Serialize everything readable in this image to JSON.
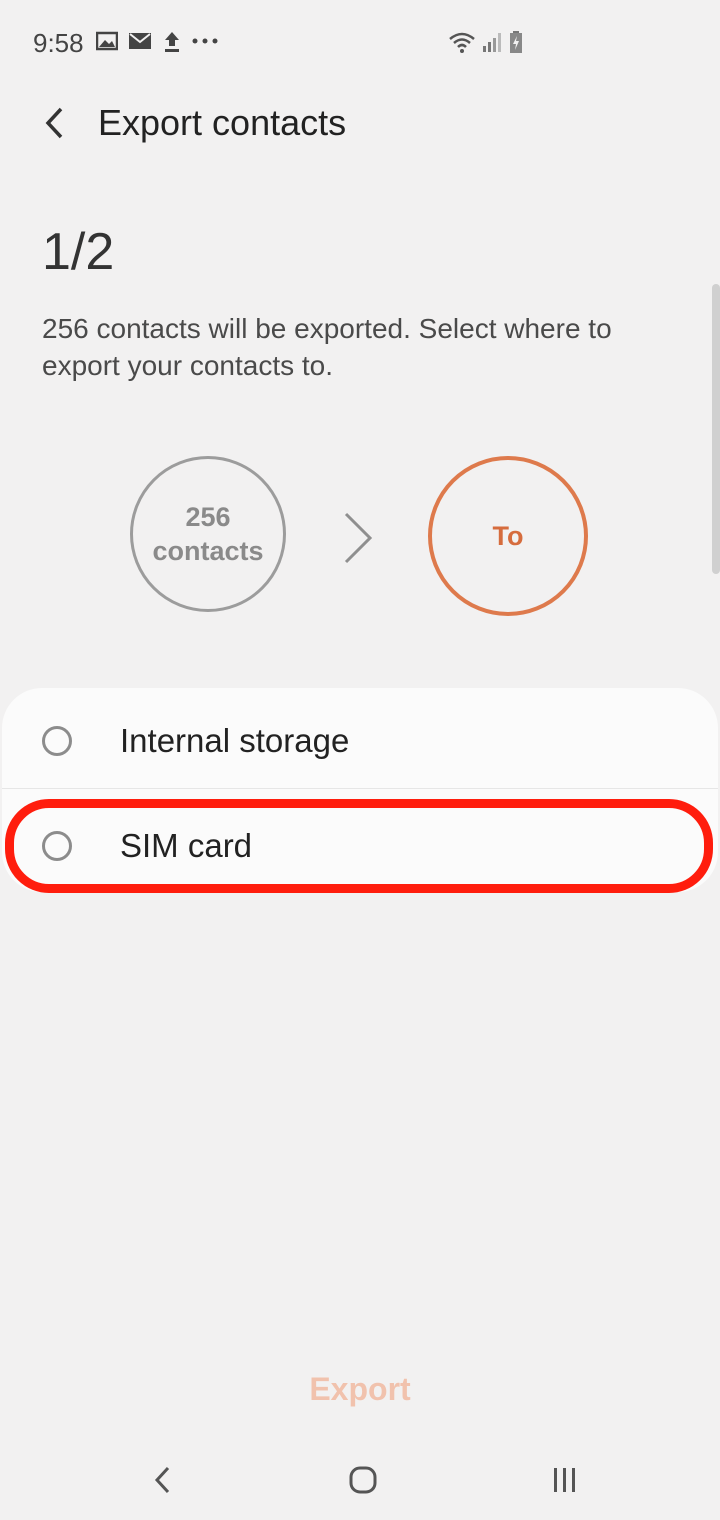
{
  "status_bar": {
    "time": "9:58",
    "left_icons": [
      "image-icon",
      "mail-icon",
      "upload-icon",
      "more-dots-icon"
    ],
    "right_icons": [
      "wifi-icon",
      "signal-icon",
      "battery-charging-icon"
    ]
  },
  "header": {
    "title": "Export contacts"
  },
  "step": "1/2",
  "description": "256 contacts will be exported. Select where to export your contacts to.",
  "flow": {
    "source_line1": "256",
    "source_line2": "contacts",
    "target": "To"
  },
  "options": [
    {
      "label": "Internal storage",
      "selected": false
    },
    {
      "label": "SIM card",
      "selected": false
    }
  ],
  "export_label": "Export",
  "colors": {
    "accent": "#de7a4c",
    "highlight": "#ff1d0d",
    "background": "#f2f1f1"
  }
}
